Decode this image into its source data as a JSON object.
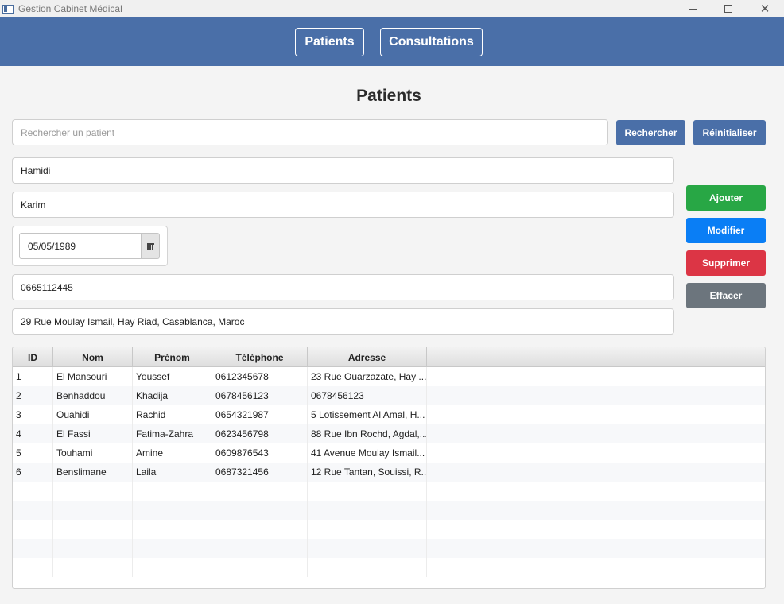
{
  "window": {
    "title": "Gestion Cabinet Médical",
    "controls": {
      "minimize": "—",
      "maximize": "□",
      "close": "✕"
    }
  },
  "navbar": {
    "patients_label": "Patients",
    "consultations_label": "Consultations",
    "color": "#4a6fa8"
  },
  "page": {
    "title": "Patients"
  },
  "search": {
    "placeholder": "Rechercher un patient",
    "search_label": "Rechercher",
    "reset_label": "Réinitialiser"
  },
  "form": {
    "nom": "Hamidi",
    "prenom": "Karim",
    "date_naissance": "05/05/1989",
    "telephone": "0665112445",
    "adresse": "29 Rue Moulay Ismail, Hay Riad, Casablanca, Maroc"
  },
  "actions": {
    "add_label": "Ajouter",
    "edit_label": "Modifier",
    "delete_label": "Supprimer",
    "clear_label": "Effacer",
    "colors": {
      "add": "#28a745",
      "edit": "#0a7ef5",
      "delete": "#dc3545",
      "clear": "#6c757d"
    }
  },
  "table": {
    "headers": [
      "ID",
      "Nom",
      "Prénom",
      "Téléphone",
      "Adresse"
    ],
    "rows": [
      [
        "1",
        "El Mansouri",
        "Youssef",
        "0612345678",
        "23 Rue Ouarzazate, Hay ..."
      ],
      [
        "2",
        "Benhaddou",
        "Khadija",
        "0678456123",
        "0678456123"
      ],
      [
        "3",
        "Ouahidi",
        "Rachid",
        "0654321987",
        "5 Lotissement Al Amal, H..."
      ],
      [
        "4",
        "El Fassi",
        "Fatima-Zahra",
        "0623456798",
        "88 Rue Ibn Rochd, Agdal,..."
      ],
      [
        "5",
        "Touhami",
        "Amine",
        "0609876543",
        "41 Avenue Moulay Ismail..."
      ],
      [
        "6",
        "Benslimane",
        "Laila",
        "0687321456",
        "12 Rue Tantan, Souissi, R..."
      ]
    ]
  },
  "icons": {
    "app": "app-window-icon",
    "calendar": "calendar-icon"
  }
}
